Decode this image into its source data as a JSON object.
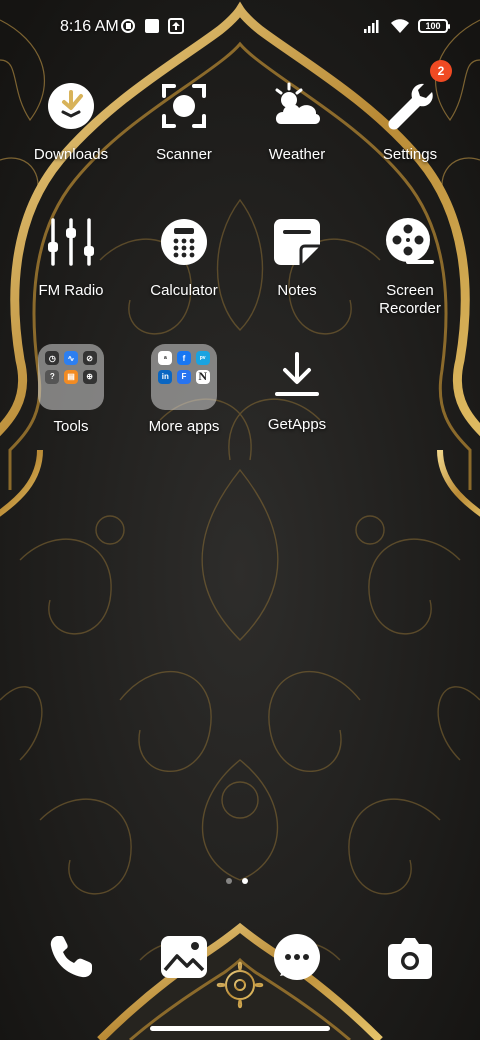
{
  "status_bar": {
    "time": "8:16 AM",
    "battery": "100"
  },
  "apps": {
    "row1": [
      {
        "label": "Downloads",
        "icon": "download-check-icon"
      },
      {
        "label": "Scanner",
        "icon": "scanner-icon"
      },
      {
        "label": "Weather",
        "icon": "weather-icon"
      },
      {
        "label": "Settings",
        "icon": "settings-wrench-icon",
        "badge": "2"
      }
    ],
    "row2": [
      {
        "label": "FM Radio",
        "icon": "fm-radio-icon"
      },
      {
        "label": "Calculator",
        "icon": "calculator-icon"
      },
      {
        "label": "Notes",
        "icon": "notes-icon"
      },
      {
        "label": "Screen Recorder",
        "icon": "film-reel-icon"
      }
    ],
    "row3": [
      {
        "label": "Tools",
        "icon": "folder-icon"
      },
      {
        "label": "More apps",
        "icon": "folder-icon"
      },
      {
        "label": "GetApps",
        "icon": "getapps-download-icon"
      }
    ]
  },
  "dock": [
    {
      "name": "phone",
      "icon": "phone-icon"
    },
    {
      "name": "gallery",
      "icon": "gallery-icon"
    },
    {
      "name": "messages",
      "icon": "messages-icon"
    },
    {
      "name": "camera",
      "icon": "camera-icon"
    }
  ],
  "pages": {
    "count": 2,
    "active": 2
  },
  "colors": {
    "accent_gold": "#c9a24a",
    "badge": "#f04a23",
    "background": "#1e1d1b"
  }
}
